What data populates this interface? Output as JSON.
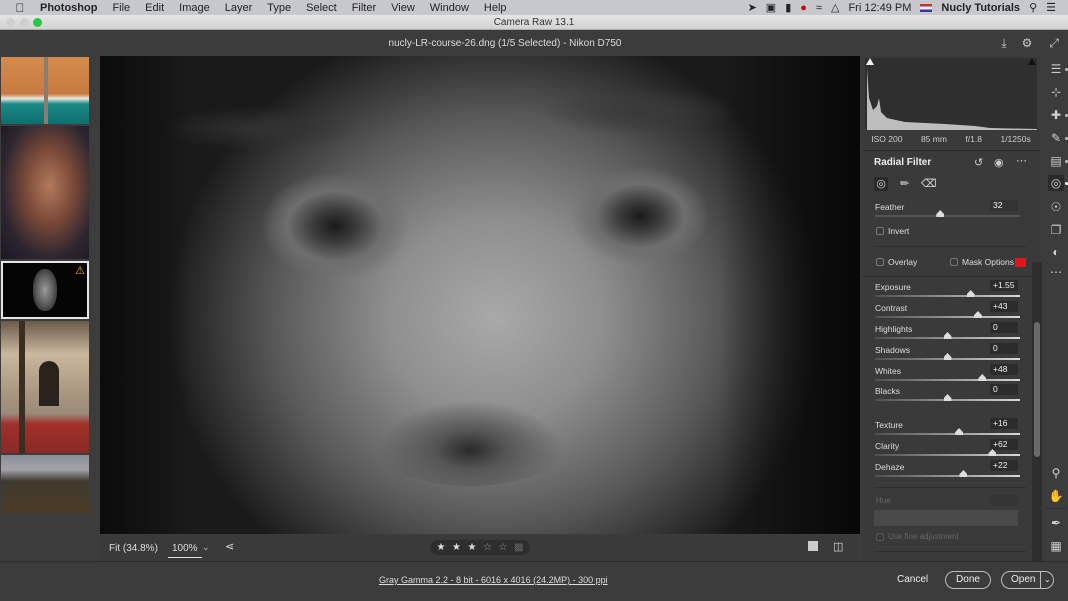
{
  "menubar": {
    "app_name": "Photoshop",
    "items": [
      "File",
      "Edit",
      "Image",
      "Layer",
      "Type",
      "Select",
      "Filter",
      "View",
      "Window",
      "Help"
    ],
    "clock": "Fri 12:49 PM",
    "user": "Nucly Tutorials"
  },
  "window": {
    "title": "Camera Raw 13.1",
    "document_title": "nucly-LR-course-26.dng (1/5 Selected)  -  Nikon D750"
  },
  "filmstrip": {
    "thumbnails": [
      {
        "name": "aerial-beach",
        "selected": false,
        "warning": false
      },
      {
        "name": "woman-veil",
        "selected": false,
        "warning": false
      },
      {
        "name": "bw-portrait",
        "selected": true,
        "warning": true
      },
      {
        "name": "building",
        "selected": false,
        "warning": false
      },
      {
        "name": "landscape",
        "selected": false,
        "warning": false
      }
    ]
  },
  "exif": {
    "iso": "ISO 200",
    "focal": "85 mm",
    "aperture": "f/1.8",
    "shutter": "1/1250s"
  },
  "panel": {
    "title": "Radial Filter",
    "feather_label": "Feather",
    "feather_value": "32",
    "feather_fraction": 0.45,
    "invert_label": "Invert",
    "overlay_label": "Overlay",
    "mask_options_label": "Mask Options",
    "mask_color": "#e8141b",
    "sliders": [
      {
        "label": "Exposure",
        "value": "+1.55",
        "fraction": 0.66
      },
      {
        "label": "Contrast",
        "value": "+43",
        "fraction": 0.71
      },
      {
        "label": "Highlights",
        "value": "0",
        "fraction": 0.5
      },
      {
        "label": "Shadows",
        "value": "0",
        "fraction": 0.5
      },
      {
        "label": "Whites",
        "value": "+48",
        "fraction": 0.74
      },
      {
        "label": "Blacks",
        "value": "0",
        "fraction": 0.5
      },
      {
        "label": "Texture",
        "value": "+16",
        "fraction": 0.58
      },
      {
        "label": "Clarity",
        "value": "+62",
        "fraction": 0.81
      },
      {
        "label": "Dehaze",
        "value": "+22",
        "fraction": 0.61
      }
    ],
    "hue_label": "Hue",
    "fine_adjust_label": "Use fine adjustment"
  },
  "bottombar": {
    "fit_label": "Fit (34.8%)",
    "zoom_label": "100%",
    "rating": 3,
    "rating_max": 5
  },
  "footer": {
    "info_link": "Gray Gamma 2.2 - 8 bit - 6016 x 4016 (24.2MP) - 300 ppi",
    "cancel": "Cancel",
    "done": "Done",
    "open": "Open"
  }
}
